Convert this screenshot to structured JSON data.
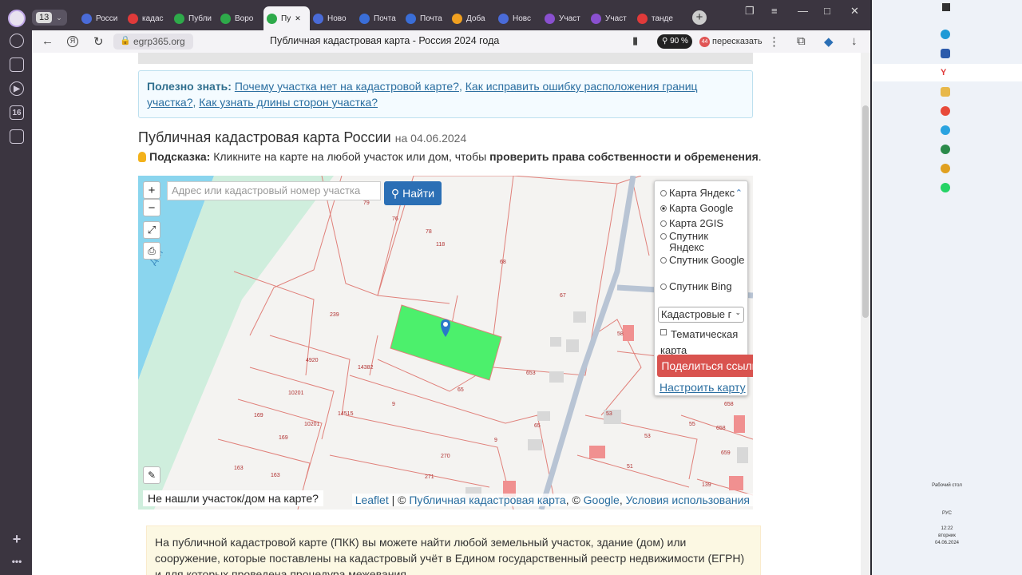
{
  "browser": {
    "tab_count": "13",
    "tabs": [
      {
        "label": "Росси",
        "color": "#4a6bd8"
      },
      {
        "label": "кадас",
        "color": "#e03a3a"
      },
      {
        "label": "Публи",
        "color": "#2eaa4a"
      },
      {
        "label": "Воро",
        "color": "#2eaa4a"
      },
      {
        "label": "Пу",
        "color": "#2eaa4a",
        "active": true
      },
      {
        "label": "Ново",
        "color": "#4a6bd8"
      },
      {
        "label": "Почта",
        "color": "#3a6ed8"
      },
      {
        "label": "Почта",
        "color": "#3a6ed8"
      },
      {
        "label": "Доба",
        "color": "#f0a020"
      },
      {
        "label": "Новс",
        "color": "#4a6bd8"
      },
      {
        "label": "Участ",
        "color": "#8a50d0"
      },
      {
        "label": "Участ",
        "color": "#8a50d0"
      },
      {
        "label": "танде",
        "color": "#e03a3a"
      }
    ],
    "url": "egrp365.org",
    "page_title": "Публичная кадастровая карта - Россия 2024 года",
    "zoom": "90 %",
    "retell_badge": "44",
    "retell": "пересказать"
  },
  "page": {
    "useful_label": "Полезно знать:",
    "useful_link1": "Почему участка нет на кадастровой карте?",
    "useful_link2": "Как исправить ошибку расположения границ участка?",
    "useful_link3": "Как узнать длины сторон участка?",
    "heading": "Публичная кадастровая карта России",
    "heading_date": "на 04.06.2024",
    "hint_label": "Подсказка:",
    "hint_text": "Кликните на карте на любой участок или дом, чтобы",
    "hint_bold": "проверить права собственности и обременения",
    "info_text": "На публичной кадастровой карте (ПКК) вы можете найти любой земельный участок, здание (дом) или сооружение, которые поставлены на кадастровый учёт в Едином государственный реестр недвижимости (ЕГРН) и для которых проведена процедура межевания."
  },
  "map": {
    "zoom_in": "+",
    "zoom_out": "−",
    "search_placeholder": "Адрес или кадастровый номер участка",
    "search_button": "Найти",
    "water_label": "Дон",
    "layers": [
      {
        "label": "Карта Яндекс",
        "selected": false
      },
      {
        "label": "Карта Google",
        "selected": true
      },
      {
        "label": "Карта 2GIS",
        "selected": false
      },
      {
        "label": "Спутник Яндекс",
        "selected": false
      },
      {
        "label": "Спутник Google",
        "selected": false
      },
      {
        "label": "Спутник Bing",
        "selected": false
      }
    ],
    "overlay_select": "Кадастровые г",
    "thematic": "Тематическая карта",
    "share_button": "Поделиться ссылкой",
    "configure_link": "Настроить карту",
    "not_found": "Не нашли участок/дом на карте?",
    "attribution": {
      "leaflet": "Leaflet",
      "sep1": " | © ",
      "pkk": "Публичная кадастровая карта",
      "sep2": ", © ",
      "google": "Google",
      "sep3": ", ",
      "terms": "Условия использования"
    },
    "parcel_labels": [
      "76",
      "79",
      "78",
      "118",
      "68",
      "67",
      "239",
      "4920",
      "14382",
      "10201",
      "10201",
      "14515",
      "169",
      "169",
      "163",
      "163",
      "9",
      "65",
      "653",
      "65",
      "9",
      "270",
      "271",
      "58",
      "53",
      "53",
      "55",
      "658",
      "658",
      "51",
      "659",
      "139"
    ]
  },
  "taskbar": {
    "desktop_label": "Рабочий стол",
    "lang": "РУС",
    "time": "12:22",
    "weekday": "вторник",
    "date": "04.06.2024"
  }
}
